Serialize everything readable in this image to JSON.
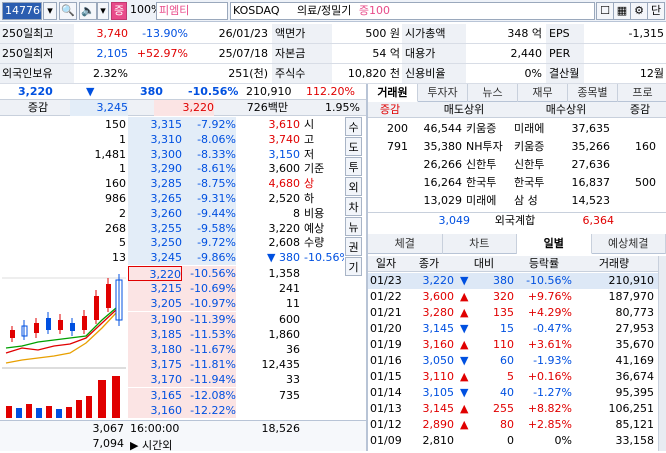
{
  "toolbar": {
    "code": "147760",
    "zoom": "100%",
    "name": "피엠티",
    "market": "KOSDAQ",
    "sector": "의료/정밀기",
    "margin": "증100",
    "lock_letter": "단",
    "badge": "증"
  },
  "info": [
    {
      "l1": "250일최고",
      "v1": "3,740",
      "p1": "-13.90%",
      "d1": "26/01/23",
      "l2": "액면가",
      "v2": "500 원",
      "l3": "시가총액",
      "v3": "348 억",
      "l4": "EPS",
      "v4": "-1,315"
    },
    {
      "l1": "250일최저",
      "v1": "2,105",
      "p1": "+52.97%",
      "d1": "25/07/18",
      "l2": "자본금",
      "v2": "54 억",
      "l3": "대용가",
      "v3": "2,440",
      "l4": "PER",
      "v4": ""
    },
    {
      "l1": "외국인보유",
      "v1": "2.32%",
      "p1": "",
      "d1": "251(천)",
      "l2": "주식수",
      "v2": "10,820 천",
      "l3": "신용비율",
      "v3": "0%",
      "l4": "결산월",
      "v4": "12월"
    }
  ],
  "quote": {
    "price": "3,220",
    "change": "380",
    "rate": "-10.56%",
    "volume": "210,910",
    "vol_rate": "112.20%"
  },
  "ob_header": {
    "label": "증감",
    "v1": "3,245",
    "v2": "3,220",
    "amount": "726백만",
    "pct": "1.95%"
  },
  "asks": [
    {
      "qty": "150",
      "price": "3,315",
      "rate": "-7.92%"
    },
    {
      "qty": "1",
      "price": "3,310",
      "rate": "-8.06%"
    },
    {
      "qty": "1,481",
      "price": "3,300",
      "rate": "-8.33%"
    },
    {
      "qty": "1",
      "price": "3,290",
      "rate": "-8.61%"
    },
    {
      "qty": "160",
      "price": "3,285",
      "rate": "-8.75%"
    },
    {
      "qty": "986",
      "price": "3,265",
      "rate": "-9.31%"
    },
    {
      "qty": "2",
      "price": "3,260",
      "rate": "-9.44%"
    },
    {
      "qty": "268",
      "price": "3,255",
      "rate": "-9.58%"
    },
    {
      "qty": "5",
      "price": "3,250",
      "rate": "-9.72%"
    },
    {
      "qty": "13",
      "price": "3,245",
      "rate": "-9.86%"
    }
  ],
  "ask_side": [
    {
      "v": "3,610",
      "k": "시"
    },
    {
      "v": "3,740",
      "k": "고"
    },
    {
      "v": "3,150",
      "k": "저"
    },
    {
      "v": "3,600",
      "k": "기준"
    },
    {
      "v": "4,680",
      "k": "상"
    },
    {
      "v": "2,520",
      "k": "하"
    },
    {
      "v": "8",
      "k": "비용"
    },
    {
      "v": "3,220",
      "k": "예상"
    },
    {
      "v": "2,608",
      "k": "수량"
    },
    {
      "v": "▼ 380",
      "k": "-10.56%"
    }
  ],
  "vtabs": [
    "수",
    "도",
    "투",
    "외",
    "차",
    "뉴",
    "권",
    "기"
  ],
  "bids": [
    {
      "price": "3,220",
      "rate": "-10.56%",
      "qty": "1,358"
    },
    {
      "price": "3,215",
      "rate": "-10.69%",
      "qty": "241"
    },
    {
      "price": "3,205",
      "rate": "-10.97%",
      "qty": "11"
    },
    {
      "price": "3,190",
      "rate": "-11.39%",
      "qty": "600"
    },
    {
      "price": "3,185",
      "rate": "-11.53%",
      "qty": "1,860"
    },
    {
      "price": "3,180",
      "rate": "-11.67%",
      "qty": "36"
    },
    {
      "price": "3,175",
      "rate": "-11.81%",
      "qty": "12,435"
    },
    {
      "price": "3,170",
      "rate": "-11.94%",
      "qty": "33"
    },
    {
      "price": "3,165",
      "rate": "-12.08%",
      "qty": "735"
    },
    {
      "price": "3,160",
      "rate": "-12.22%",
      "qty": ""
    }
  ],
  "ob_footer": {
    "ask_total": "3,067",
    "bid_total": "18,526",
    "time": "16:00:00",
    "after_qty": "7,094",
    "after_label": "시간외"
  },
  "broker_tabs": [
    "거래원",
    "투자자",
    "뉴스",
    "재무",
    "종목별",
    "프로"
  ],
  "broker_header": {
    "c0": "증감",
    "c1": "매도상위",
    "c2": "매수상위",
    "c3": "증감"
  },
  "brokers": [
    {
      "d1": "200",
      "sq": "46,544",
      "sn": "키움증",
      "bn": "미래에",
      "bq": "37,635",
      "d2": ""
    },
    {
      "d1": "791",
      "sq": "35,380",
      "sn": "NH투자",
      "bn": "키움증",
      "bq": "35,266",
      "d2": "160"
    },
    {
      "d1": "",
      "sq": "26,266",
      "sn": "신한투",
      "bn": "신한투",
      "bq": "27,636",
      "d2": ""
    },
    {
      "d1": "",
      "sq": "16,264",
      "sn": "한국투",
      "bn": "한국투",
      "bq": "16,837",
      "d2": "500"
    },
    {
      "d1": "",
      "sq": "13,029",
      "sn": "미래에",
      "bn": "삼 성",
      "bq": "14,523",
      "d2": ""
    }
  ],
  "foreign": {
    "sell": "3,049",
    "label": "외국계합",
    "buy": "6,364"
  },
  "lower_tabs": [
    "체결",
    "차트",
    "일별",
    "예상체결"
  ],
  "daily_header": [
    "일자",
    "종가",
    "대비",
    "등락률",
    "거래량"
  ],
  "daily": [
    {
      "date": "01/23",
      "close": "3,220",
      "dir": "▼",
      "chg": "380",
      "rate": "-10.56%",
      "vol": "210,910"
    },
    {
      "date": "01/22",
      "close": "3,600",
      "dir": "▲",
      "chg": "320",
      "rate": "+9.76%",
      "vol": "187,970"
    },
    {
      "date": "01/21",
      "close": "3,280",
      "dir": "▲",
      "chg": "135",
      "rate": "+4.29%",
      "vol": "80,773"
    },
    {
      "date": "01/20",
      "close": "3,145",
      "dir": "▼",
      "chg": "15",
      "rate": "-0.47%",
      "vol": "27,953"
    },
    {
      "date": "01/19",
      "close": "3,160",
      "dir": "▲",
      "chg": "110",
      "rate": "+3.61%",
      "vol": "35,670"
    },
    {
      "date": "01/16",
      "close": "3,050",
      "dir": "▼",
      "chg": "60",
      "rate": "-1.93%",
      "vol": "41,169"
    },
    {
      "date": "01/15",
      "close": "3,110",
      "dir": "▲",
      "chg": "5",
      "rate": "+0.16%",
      "vol": "36,674"
    },
    {
      "date": "01/14",
      "close": "3,105",
      "dir": "▼",
      "chg": "40",
      "rate": "-1.27%",
      "vol": "95,395"
    },
    {
      "date": "01/13",
      "close": "3,145",
      "dir": "▲",
      "chg": "255",
      "rate": "+8.82%",
      "vol": "106,251"
    },
    {
      "date": "01/12",
      "close": "2,890",
      "dir": "▲",
      "chg": "80",
      "rate": "+2.85%",
      "vol": "85,121"
    },
    {
      "date": "01/09",
      "close": "2,810",
      "dir": "",
      "chg": "0",
      "rate": "0%",
      "vol": "33,158"
    }
  ],
  "colors": {
    "up": "#e00000",
    "down": "#0050e0",
    "accent": "#e84b8a"
  }
}
